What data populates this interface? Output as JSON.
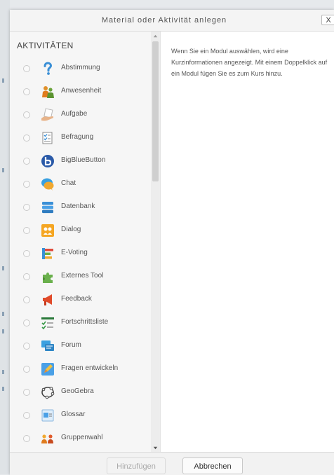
{
  "dialog": {
    "title": "Material oder Aktivität anlegen",
    "close_label": "X"
  },
  "list": {
    "heading": "AKTIVITÄTEN",
    "items": [
      {
        "label": "Abstimmung",
        "icon": "question-mark-icon"
      },
      {
        "label": "Anwesenheit",
        "icon": "attendance-people-icon"
      },
      {
        "label": "Aufgabe",
        "icon": "assignment-hand-icon"
      },
      {
        "label": "Befragung",
        "icon": "survey-checklist-icon"
      },
      {
        "label": "BigBlueButton",
        "icon": "bigbluebutton-icon"
      },
      {
        "label": "Chat",
        "icon": "chat-bubble-icon"
      },
      {
        "label": "Datenbank",
        "icon": "database-icon"
      },
      {
        "label": "Dialog",
        "icon": "dialogue-icon"
      },
      {
        "label": "E-Voting",
        "icon": "bar-chart-icon"
      },
      {
        "label": "Externes Tool",
        "icon": "puzzle-icon"
      },
      {
        "label": "Feedback",
        "icon": "megaphone-icon"
      },
      {
        "label": "Fortschrittsliste",
        "icon": "progress-checklist-icon"
      },
      {
        "label": "Forum",
        "icon": "forum-icon"
      },
      {
        "label": "Fragen entwickeln",
        "icon": "pencil-icon"
      },
      {
        "label": "GeoGebra",
        "icon": "geogebra-icon"
      },
      {
        "label": "Glossar",
        "icon": "glossary-book-icon"
      },
      {
        "label": "Gruppenwahl",
        "icon": "group-choice-icon"
      }
    ]
  },
  "summary": {
    "text": "Wenn Sie ein Modul auswählen, wird eine Kurzinformationen angezeigt. Mit einem Doppelklick auf ein Modul fügen Sie es zum Kurs hinzu."
  },
  "footer": {
    "add_label": "Hinzufügen",
    "cancel_label": "Abbrechen"
  },
  "colors": {
    "accent_blue": "#2a6db5",
    "header_bg": "#f4f4f4",
    "list_bg": "#f6f6f6"
  }
}
